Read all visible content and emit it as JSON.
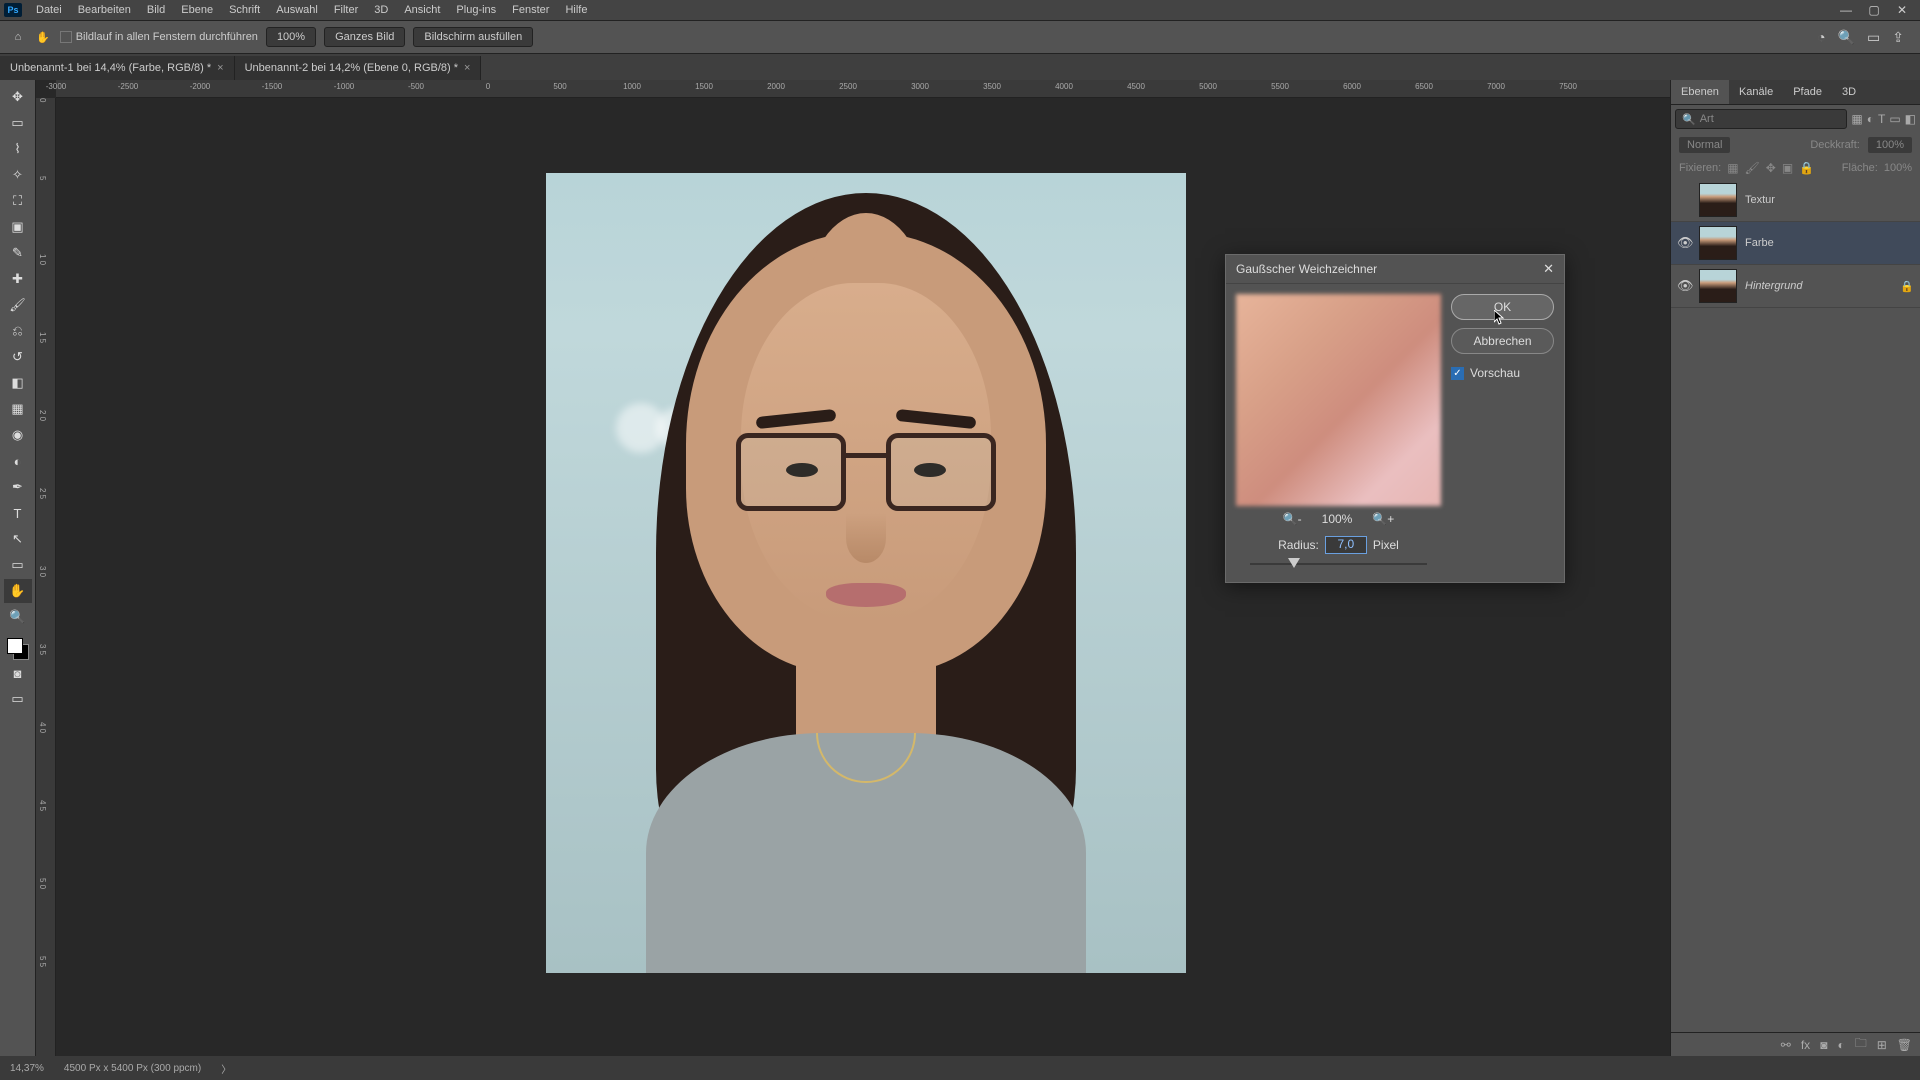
{
  "menubar": {
    "items": [
      "Datei",
      "Bearbeiten",
      "Bild",
      "Ebene",
      "Schrift",
      "Auswahl",
      "Filter",
      "3D",
      "Ansicht",
      "Plug-ins",
      "Fenster",
      "Hilfe"
    ],
    "ps": "Ps"
  },
  "optbar": {
    "scroll_all_label": "Bildlauf in allen Fenstern durchführen",
    "zoom_label": "100%",
    "fit_label": "Ganzes Bild",
    "fill_label": "Bildschirm ausfüllen"
  },
  "tabs": [
    {
      "title": "Unbenannt-1 bei 14,4% (Farbe, RGB/8) *"
    },
    {
      "title": "Unbenannt-2 bei 14,2% (Ebene 0, RGB/8) *"
    }
  ],
  "ruler_h": [
    "-3000",
    "-2500",
    "-2000",
    "-1500",
    "-1000",
    "-500",
    "0",
    "500",
    "1000",
    "1500",
    "2000",
    "2500",
    "3000",
    "3500",
    "4000",
    "4500",
    "5000",
    "5500",
    "6000",
    "6500",
    "7000",
    "7500"
  ],
  "ruler_v": [
    "0",
    "5",
    "1 0",
    "1 5",
    "2 0",
    "2 5",
    "3 0",
    "3 5",
    "4 0",
    "4 5",
    "5 0",
    "5 5"
  ],
  "panels": {
    "tabs": [
      "Ebenen",
      "Kanäle",
      "Pfade",
      "3D"
    ],
    "search_placeholder": "Art",
    "blend_mode": "Normal",
    "opacity_label": "Deckkraft:",
    "opacity_value": "100%",
    "lock_label": "Fixieren:",
    "fill_label": "Fläche:",
    "fill_value": "100%",
    "layers": [
      {
        "name": "Textur",
        "visible": false,
        "locked": false,
        "selected": false
      },
      {
        "name": "Farbe",
        "visible": true,
        "locked": false,
        "selected": true
      },
      {
        "name": "Hintergrund",
        "visible": true,
        "locked": true,
        "selected": false,
        "italic": true
      }
    ]
  },
  "dialog": {
    "title": "Gaußscher Weichzeichner",
    "ok": "OK",
    "cancel": "Abbrechen",
    "preview_check": "Vorschau",
    "zoom_level": "100%",
    "radius_label": "Radius:",
    "radius_value": "7,0",
    "radius_unit": "Pixel"
  },
  "status": {
    "zoom": "14,37%",
    "doc": "4500 Px x 5400 Px (300 ppcm)",
    "arrow": "〉"
  }
}
